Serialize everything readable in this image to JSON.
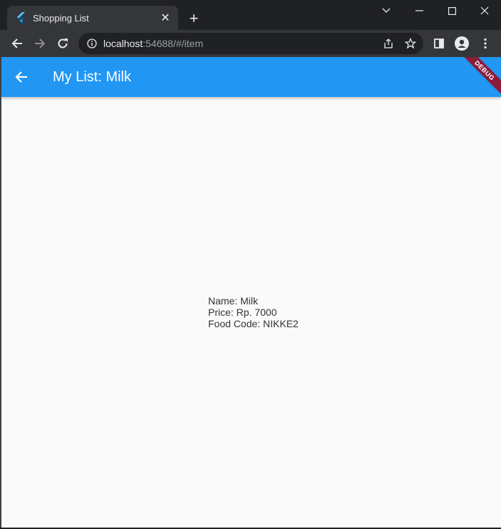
{
  "browser": {
    "tab": {
      "title": "Shopping List",
      "favicon": "flutter-icon"
    },
    "new_tab_icon": "plus-icon",
    "window_controls": [
      "tab-search-icon",
      "minimize-icon",
      "maximize-icon",
      "close-icon"
    ],
    "url": {
      "host": "localhost",
      "rest": ":54688/#/item"
    }
  },
  "app": {
    "appbar": {
      "title": "My List: Milk",
      "color": "#2196f3"
    },
    "debug_banner": "DEBUG",
    "item": {
      "name_line": "Name: Milk",
      "price_line": "Price: Rp. 7000",
      "code_line": "Food Code: NIKKE2"
    }
  }
}
